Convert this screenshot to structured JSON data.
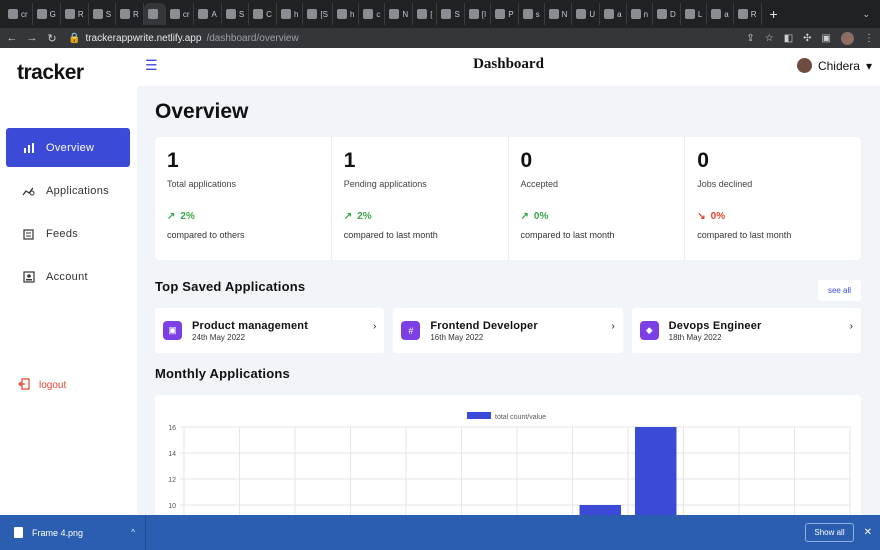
{
  "browser": {
    "tabs": [
      "cr",
      "G",
      "R",
      "S",
      "R",
      "",
      "cr",
      "A",
      "S",
      "C",
      "h",
      "[S",
      "h",
      "c",
      "N",
      "[",
      "S",
      "[I",
      "P",
      "s",
      "N",
      "U",
      "a",
      "n",
      "D",
      "L",
      "a",
      "R"
    ],
    "active_tab_index": 5,
    "new_tab": "+",
    "url_domain": "trackerappwrite.netlify.app",
    "url_path": "/dashboard/overview"
  },
  "app": {
    "logo": "tracker",
    "page_heading": "Dashboard",
    "user_name": "Chidera",
    "sidebar": {
      "items": [
        {
          "label": "Overview",
          "icon": "bar-chart-icon",
          "active": true
        },
        {
          "label": "Applications",
          "icon": "trend-search-icon",
          "active": false
        },
        {
          "label": "Feeds",
          "icon": "feeds-icon",
          "active": false
        },
        {
          "label": "Account",
          "icon": "account-icon",
          "active": false
        }
      ],
      "logout_label": "logout"
    },
    "overview_title": "Overview",
    "stats": [
      {
        "value": "1",
        "label": "Total applications",
        "pct": "2%",
        "trend": "up",
        "compare": "compared to others"
      },
      {
        "value": "1",
        "label": "Pending applications",
        "pct": "2%",
        "trend": "up",
        "compare": "compared to last month"
      },
      {
        "value": "0",
        "label": "Accepted",
        "pct": "0%",
        "trend": "up",
        "compare": "compared to last month"
      },
      {
        "value": "0",
        "label": "Jobs declined",
        "pct": "0%",
        "trend": "down",
        "compare": "compared to last month"
      }
    ],
    "top_saved_title": "Top Saved Applications",
    "see_all_label": "see all",
    "saved_applications": [
      {
        "title": "Product management",
        "date": "24th May 2022",
        "icon": "twitch-icon"
      },
      {
        "title": "Frontend Developer",
        "date": "16th May 2022",
        "icon": "slack-icon"
      },
      {
        "title": "Devops Engineer",
        "date": "18th May 2022",
        "icon": "dropbox-icon"
      }
    ],
    "monthly_title": "Monthly Applications",
    "colors": {
      "accent": "#3b4bd8",
      "up": "#3aa84a",
      "down": "#e0452f",
      "saved_icon": "#7b3fe4"
    }
  },
  "chart_data": {
    "type": "bar",
    "legend": [
      "total count/value"
    ],
    "series": [
      {
        "name": "total count/value",
        "values": [
          null,
          null,
          null,
          null,
          null,
          null,
          null,
          10,
          16,
          null,
          null,
          null
        ]
      }
    ],
    "y_ticks": [
      16,
      14,
      12,
      10
    ],
    "ylim": [
      0,
      16
    ],
    "grid": true,
    "legend_position": "top-center"
  },
  "downloads": {
    "file_name": "Frame 4.png",
    "show_all_label": "Show all"
  }
}
